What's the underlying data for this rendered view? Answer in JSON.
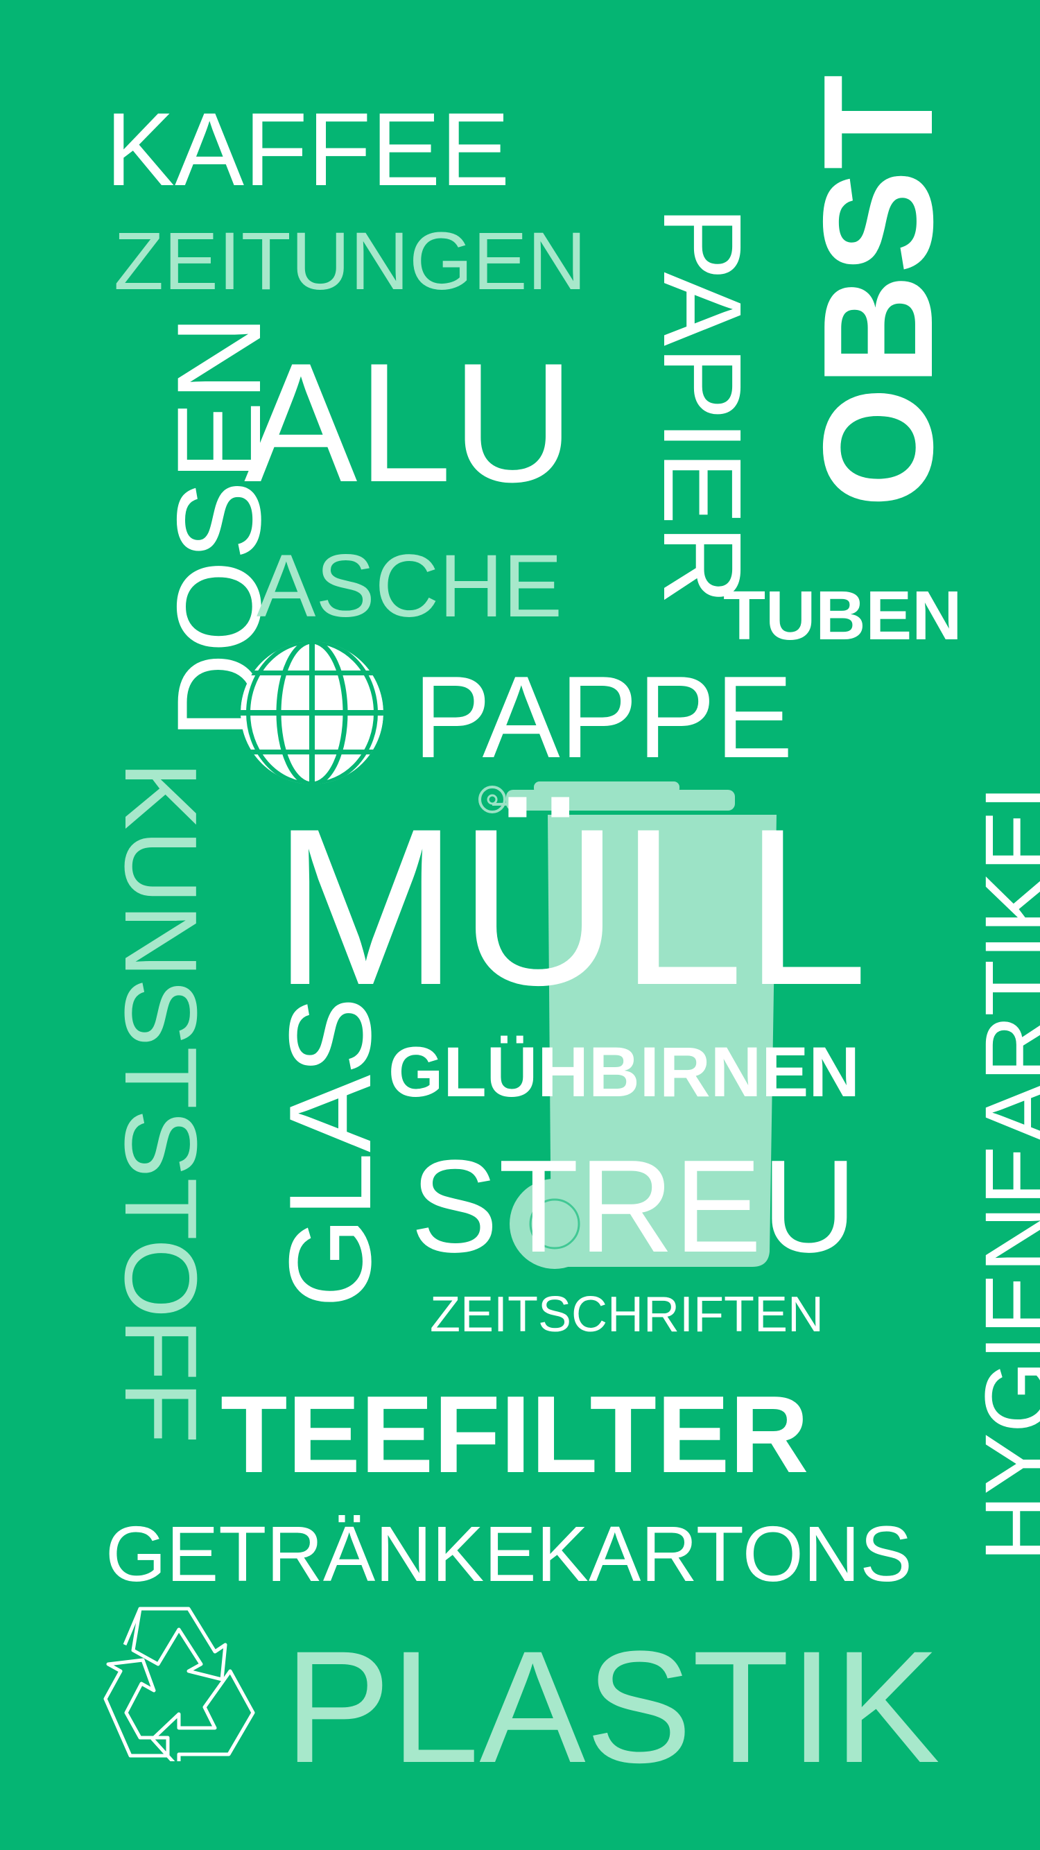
{
  "words": {
    "kaffee": "KAFFEE",
    "zeitungen": "ZEITUNGEN",
    "papier": "PAPIER",
    "obst": "OBST",
    "dosen": "DOSEN",
    "alu": "ALU",
    "asche": "ASCHE",
    "tuben": "TUBEN",
    "pappe": "PAPPE",
    "kunststoff": "KUNSTSTOFF",
    "muell": "MÜLL",
    "hygieneartikel": "HYGIENEARTIKEL",
    "glas": "GLAS",
    "gluehbirnen": "GLÜHBIRNEN",
    "streu": "STREU",
    "zeitschriften": "ZEITSCHRIFTEN",
    "teefilter": "TEEFILTER",
    "getraenkekartons": "GETRÄNKEKARTONS",
    "plastik": "PLASTIK"
  },
  "icons": {
    "globe": "globe-icon",
    "trash_bin": "trash-bin-icon",
    "recycle": "recycle-icon"
  },
  "colors": {
    "background": "#05b573",
    "primary_text": "#ffffff",
    "accent_text": "#a7e8cb",
    "bin_fill": "#9ce3c6"
  }
}
